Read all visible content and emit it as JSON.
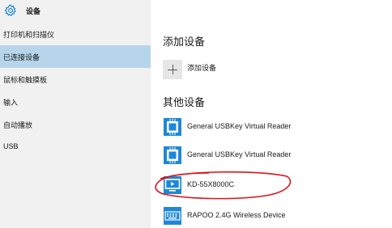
{
  "app": {
    "title": "设备"
  },
  "sidebar": {
    "items": [
      {
        "label": "打印机和扫描仪",
        "selected": false
      },
      {
        "label": "已连接设备",
        "selected": true
      },
      {
        "label": "鼠标和触摸板",
        "selected": false
      },
      {
        "label": "输入",
        "selected": false
      },
      {
        "label": "自动播放",
        "selected": false
      },
      {
        "label": "USB",
        "selected": false
      }
    ]
  },
  "main": {
    "add_section_title": "添加设备",
    "add_button_label": "添加设备",
    "other_section_title": "其他设备",
    "devices": [
      {
        "name": "General USBKey Virtual Reader",
        "icon": "chip-icon"
      },
      {
        "name": "General USBKey Virtual Reader",
        "icon": "chip-icon"
      },
      {
        "name": "KD-55X8000C",
        "icon": "display-icon"
      },
      {
        "name": "RAPOO 2.4G Wireless Device",
        "icon": "keyboard-icon"
      }
    ]
  },
  "colors": {
    "accent": "#1e88d6",
    "selected_bg": "#b6d5ea",
    "sidebar_bg": "#f1f1f1",
    "annotation": "#d8141c"
  }
}
